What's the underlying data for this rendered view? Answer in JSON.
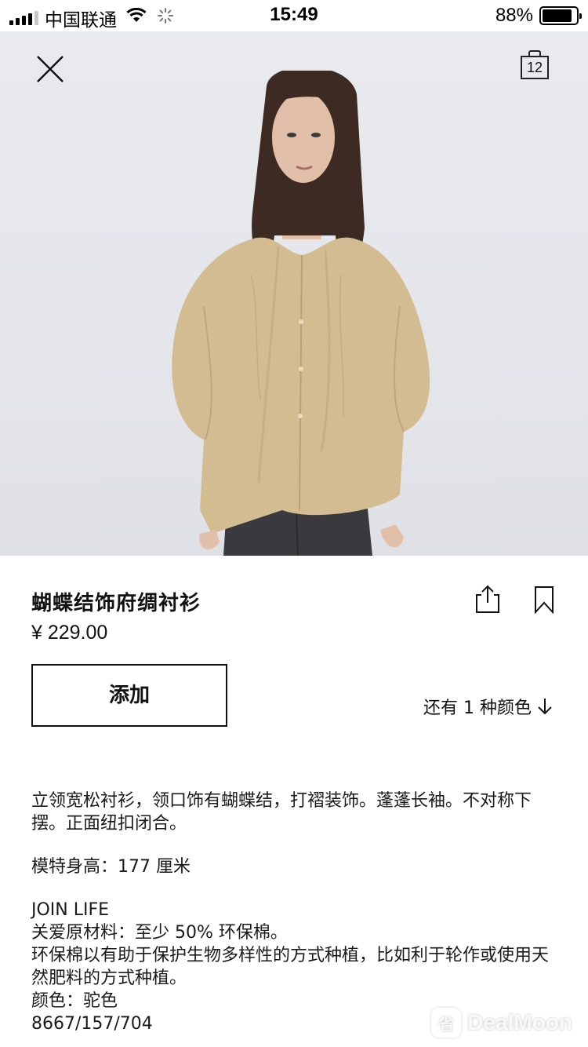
{
  "status_bar": {
    "carrier": "中国联通",
    "time": "15:49",
    "battery_percent": "88%",
    "battery_level": 0.88
  },
  "header": {
    "close_icon": "close-icon",
    "cart_count": "12"
  },
  "product": {
    "name": "蝴蝶结饰府绸衬衫",
    "price": "¥ 229.00",
    "add_label": "添加",
    "more_colors": "还有 1 种颜色",
    "colors": {
      "shirt": "#d4bc92",
      "jeans": "#3a3a3e",
      "hair": "#3d2a22",
      "skin": "#e2bfa8"
    }
  },
  "description": {
    "paragraph1": "立领宽松衬衫，领口饰有蝴蝶结，打褶装饰。蓬蓬长袖。不对称下摆。正面纽扣闭合。",
    "model_height": "模特身高：177 厘米",
    "join_life": "JOIN LIFE",
    "material": "关爱原材料：至少 50% 环保棉。",
    "cotton_note": "环保棉以有助于保护生物多样性的方式种植，比如利于轮作或使用天然肥料的方式种植。",
    "color": "颜色：驼色",
    "reference": "8667/157/704"
  },
  "watermark": {
    "text": "DealMoon",
    "logo_glyph": "省"
  }
}
